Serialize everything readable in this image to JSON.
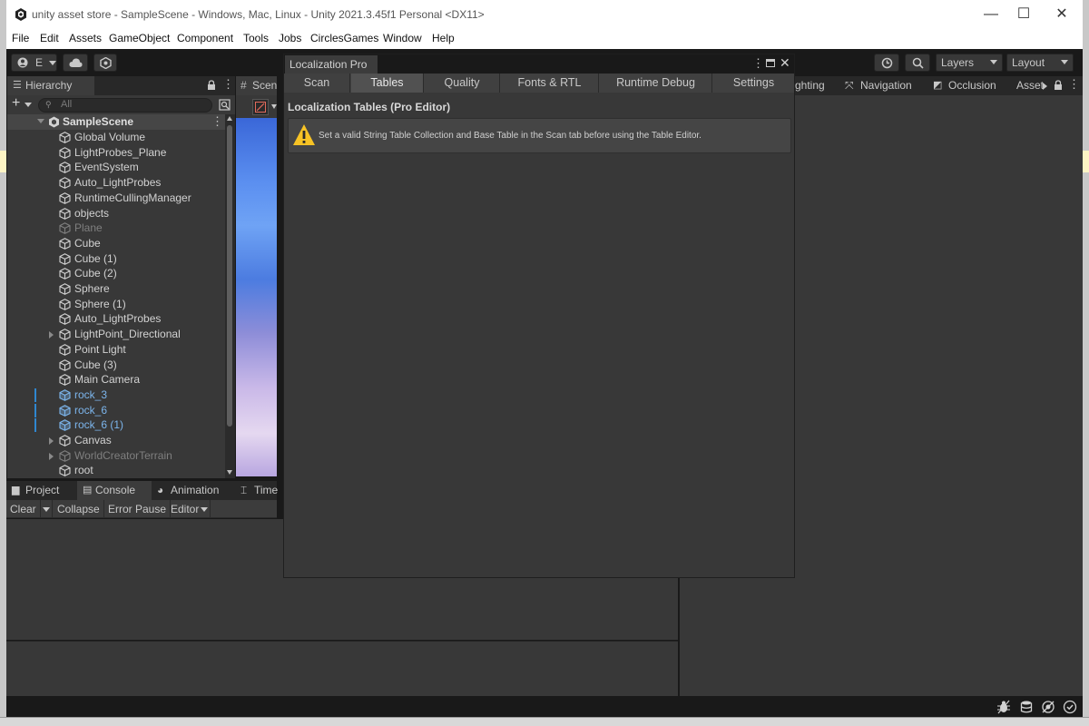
{
  "window": {
    "title": "unity asset store - SampleScene - Windows, Mac, Linux - Unity 2021.3.45f1 Personal <DX11>",
    "minimize": "—",
    "maximize": "☐",
    "close": "✕"
  },
  "menu": [
    "File",
    "Edit",
    "Assets",
    "GameObject",
    "Component",
    "Tools",
    "Jobs",
    "CirclesGames",
    "Window",
    "Help"
  ],
  "toolbar": {
    "account_label": "E",
    "layers_label": "Layers",
    "layout_label": "Layout"
  },
  "hierarchy": {
    "tab_label": "Hierarchy",
    "search_placeholder": "All",
    "scene_name": "SampleScene",
    "items": [
      {
        "label": "Global Volume",
        "state": "normal"
      },
      {
        "label": "LightProbes_Plane",
        "state": "normal"
      },
      {
        "label": "EventSystem",
        "state": "normal"
      },
      {
        "label": "Auto_LightProbes",
        "state": "normal"
      },
      {
        "label": "RuntimeCullingManager",
        "state": "normal"
      },
      {
        "label": "objects",
        "state": "normal"
      },
      {
        "label": "Plane",
        "state": "dim"
      },
      {
        "label": "Cube",
        "state": "normal"
      },
      {
        "label": "Cube (1)",
        "state": "normal"
      },
      {
        "label": "Cube (2)",
        "state": "normal"
      },
      {
        "label": "Sphere",
        "state": "normal"
      },
      {
        "label": "Sphere (1)",
        "state": "normal"
      },
      {
        "label": "Auto_LightProbes",
        "state": "normal"
      },
      {
        "label": "LightPoint_Directional",
        "state": "normal",
        "expandable": true
      },
      {
        "label": "Point Light",
        "state": "normal"
      },
      {
        "label": "Cube (3)",
        "state": "normal"
      },
      {
        "label": "Main Camera",
        "state": "normal"
      },
      {
        "label": "rock_3",
        "state": "blue"
      },
      {
        "label": "rock_6",
        "state": "blue"
      },
      {
        "label": "rock_6 (1)",
        "state": "blue"
      },
      {
        "label": "Canvas",
        "state": "normal",
        "expandable": true
      },
      {
        "label": "WorldCreatorTerrain",
        "state": "dim",
        "expandable": true
      },
      {
        "label": "root",
        "state": "normal"
      }
    ]
  },
  "scene_tab": {
    "label": "Scen"
  },
  "localization": {
    "title": "Localization Pro",
    "tabs": [
      "Scan",
      "Tables",
      "Quality",
      "Fonts & RTL",
      "Runtime Debug",
      "Settings"
    ],
    "selected_tab": "Tables",
    "heading": "Localization Tables (Pro Editor)",
    "message": "Set a valid String Table Collection and Base Table in the Scan tab before using the Table Editor."
  },
  "right_tabs": [
    "ghting",
    "Navigation",
    "Occlusion",
    "Asset"
  ],
  "bottom_tabs": [
    "Project",
    "Console",
    "Animation",
    "Time"
  ],
  "console": {
    "clear": "Clear",
    "collapse": "Collapse",
    "error_pause": "Error Pause",
    "editor": "Editor"
  },
  "colors": {
    "accent_blue": "#7cb5ec",
    "panel_bg": "#383838",
    "warning_yellow": "#f7c325"
  }
}
